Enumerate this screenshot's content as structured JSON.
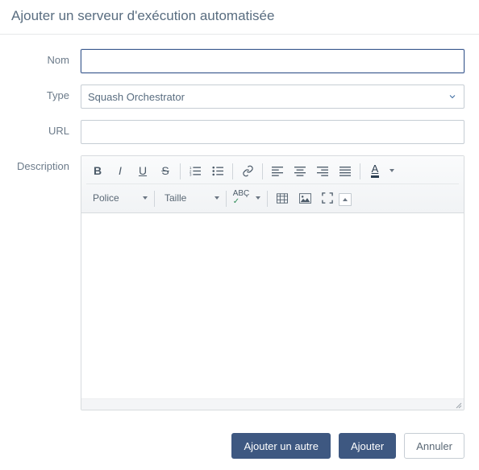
{
  "dialog": {
    "title": "Ajouter un serveur d'exécution automatisée"
  },
  "labels": {
    "name": "Nom",
    "type": "Type",
    "url": "URL",
    "description": "Description"
  },
  "form": {
    "name": "",
    "type_selected": "Squash Orchestrator",
    "url": ""
  },
  "rte": {
    "font_label": "Police",
    "size_label": "Taille"
  },
  "buttons": {
    "add_another": "Ajouter un autre",
    "add": "Ajouter",
    "cancel": "Annuler"
  }
}
